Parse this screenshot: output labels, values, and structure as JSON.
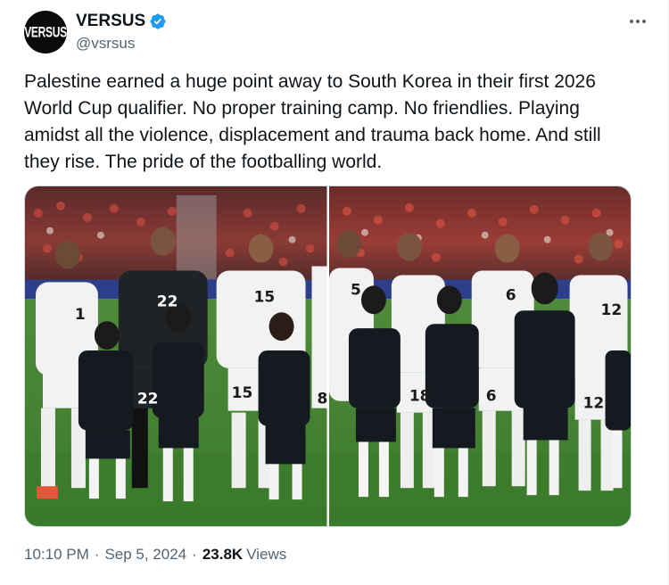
{
  "author": {
    "avatar_text": "VERSUS",
    "display_name": "VERSUS",
    "handle": "@vsrsus",
    "verified": true
  },
  "tweet": {
    "text": "Palestine earned a huge point away to South Korea in their first 2026 World Cup qualifier. No proper training camp. No friendlies. Playing amidst all the violence, displacement and trauma back home. And still they rise. The pride of the footballing world."
  },
  "media": {
    "left": {
      "jersey_numbers": [
        "1",
        "22",
        "22",
        "15",
        "15",
        "8"
      ]
    },
    "right": {
      "jersey_numbers": [
        "5",
        "6",
        "18",
        "6",
        "12",
        "12"
      ]
    }
  },
  "meta": {
    "time": "10:10 PM",
    "date": "Sep 5, 2024",
    "views_count": "23.8K",
    "views_label": "Views"
  },
  "colors": {
    "verified_blue": "#1d9bf0",
    "secondary_text": "#536471",
    "primary_text": "#0f1419"
  },
  "icons": {
    "verified": "verified-badge-icon",
    "more": "more-options-icon"
  }
}
